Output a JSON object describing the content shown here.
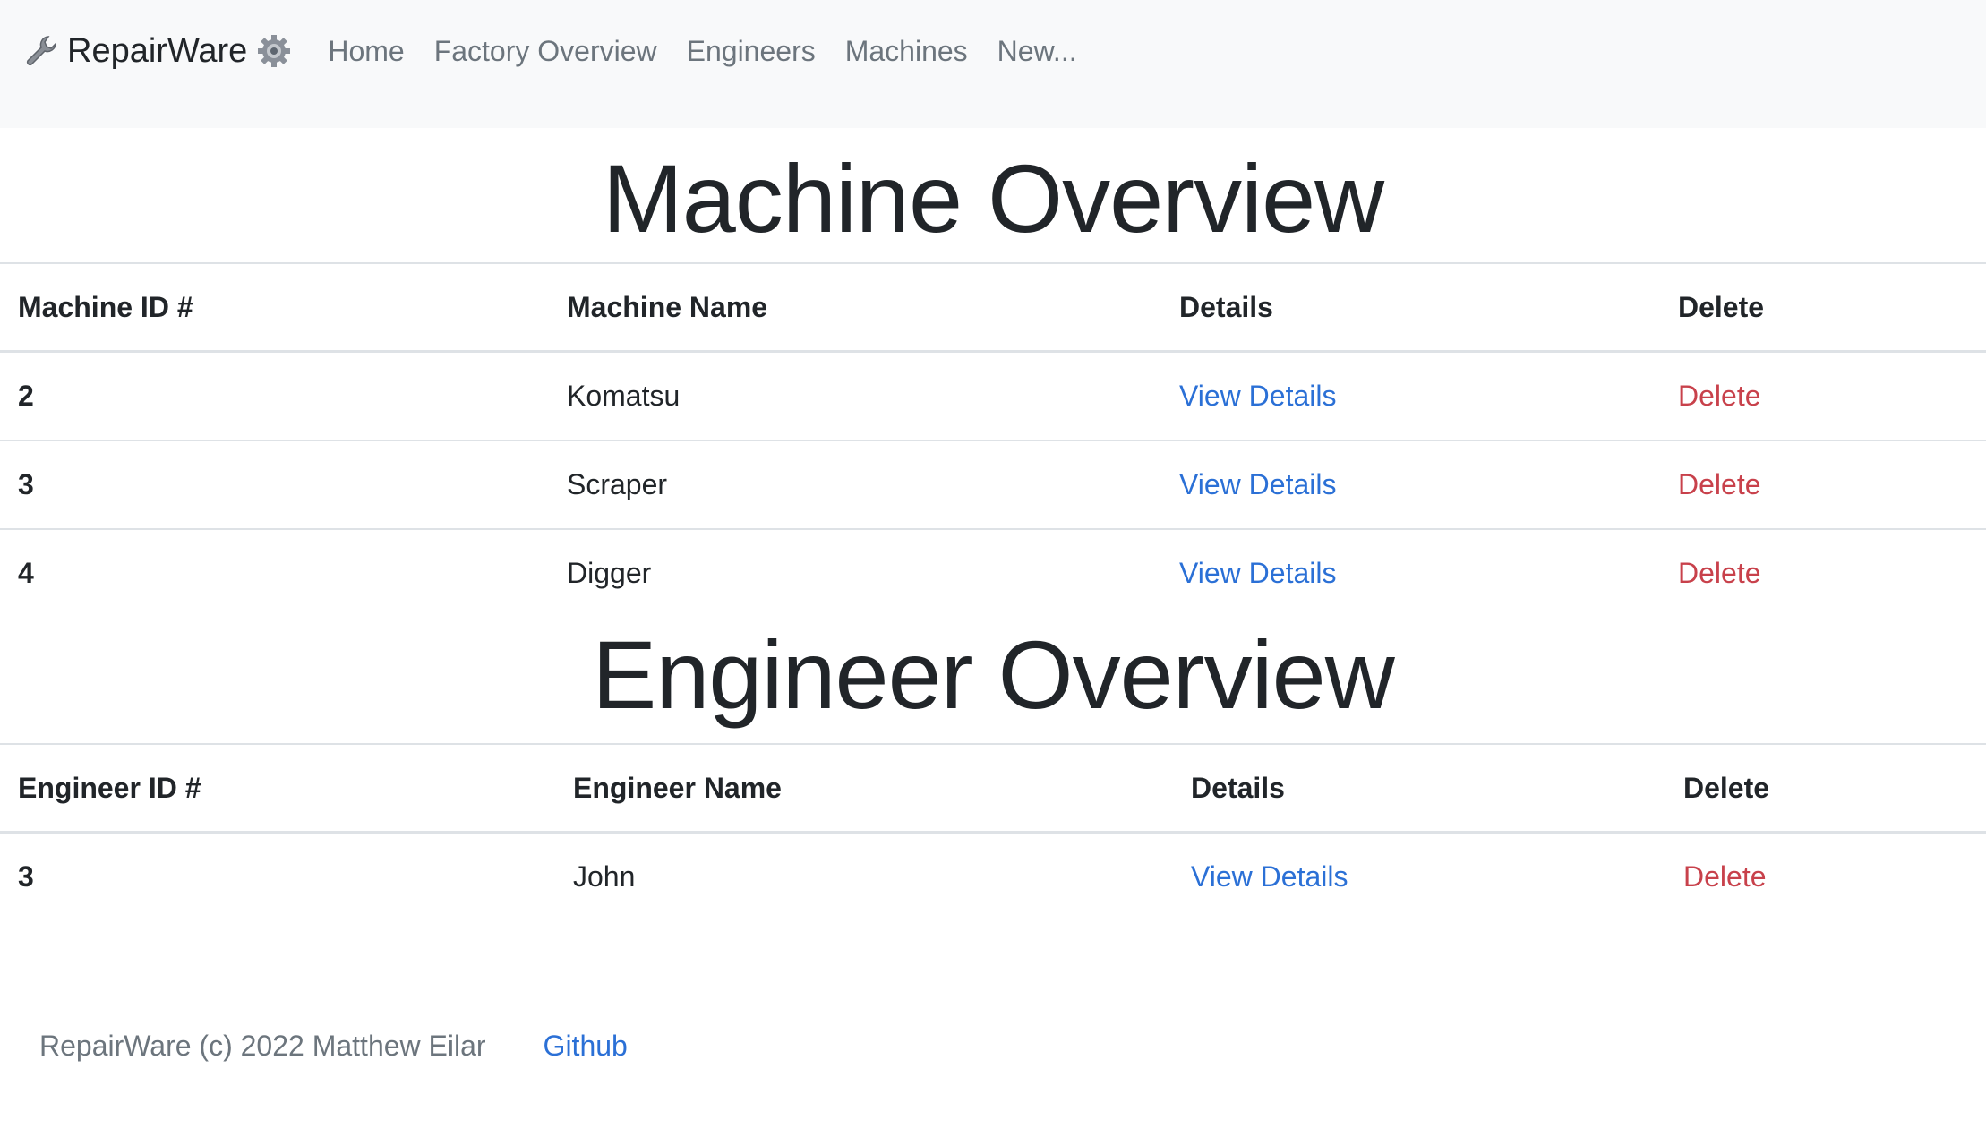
{
  "nav": {
    "brand": "RepairWare",
    "brand_left_icon": "wrench-icon",
    "brand_right_icon": "gear-icon",
    "links": [
      "Home",
      "Factory Overview",
      "Engineers",
      "Machines",
      "New..."
    ]
  },
  "machines": {
    "title": "Machine Overview",
    "headers": [
      "Machine ID #",
      "Machine Name",
      "Details",
      "Delete"
    ],
    "rows": [
      {
        "id": "2",
        "name": "Komatsu",
        "details": "View Details",
        "delete": "Delete"
      },
      {
        "id": "3",
        "name": "Scraper",
        "details": "View Details",
        "delete": "Delete"
      },
      {
        "id": "4",
        "name": "Digger",
        "details": "View Details",
        "delete": "Delete"
      }
    ]
  },
  "engineers": {
    "title": "Engineer Overview",
    "headers": [
      "Engineer ID #",
      "Engineer Name",
      "Details",
      "Delete"
    ],
    "rows": [
      {
        "id": "3",
        "name": "John",
        "details": "View Details",
        "delete": "Delete"
      }
    ]
  },
  "footer": {
    "copyright": "RepairWare (c) 2022 Matthew Eilar",
    "github": "Github"
  },
  "colors": {
    "link": "#2b70d6",
    "delete": "#c8414b",
    "nav_bg": "#f8f9fa"
  }
}
